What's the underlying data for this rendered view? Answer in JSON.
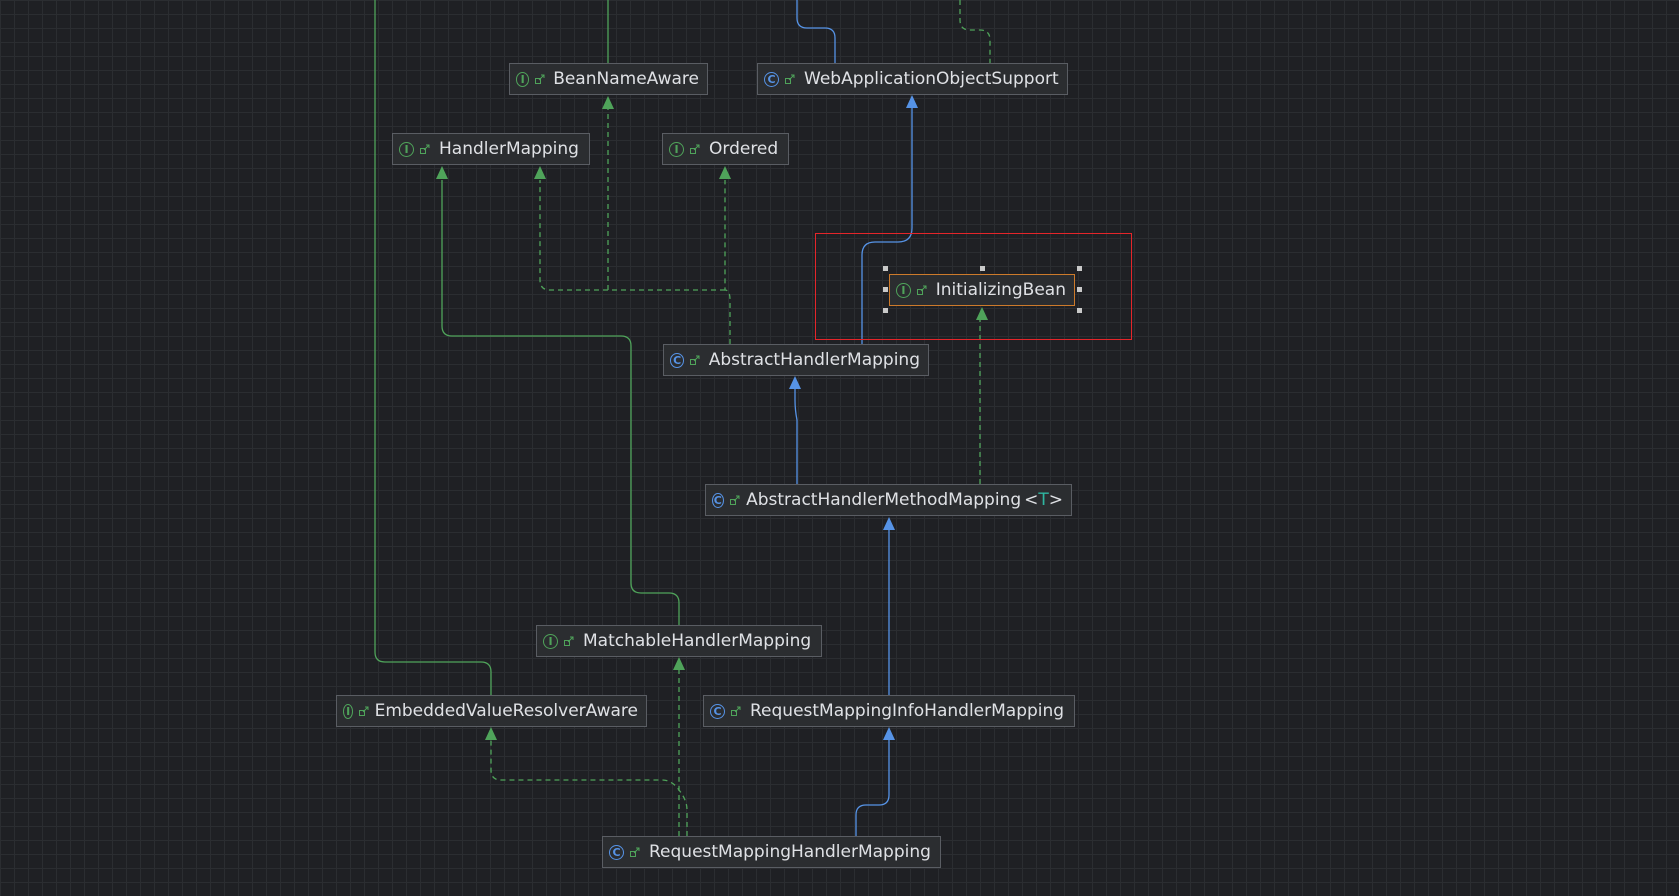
{
  "diagram": {
    "nodes": [
      {
        "id": "BeanNameAware",
        "label": "BeanNameAware",
        "kind": "interface"
      },
      {
        "id": "WebApplicationObjectSupport",
        "label": "WebApplicationObjectSupport",
        "kind": "class"
      },
      {
        "id": "HandlerMapping",
        "label": "HandlerMapping",
        "kind": "interface"
      },
      {
        "id": "Ordered",
        "label": "Ordered",
        "kind": "interface"
      },
      {
        "id": "InitializingBean",
        "label": "InitializingBean",
        "kind": "interface",
        "selected": true
      },
      {
        "id": "AbstractHandlerMapping",
        "label": "AbstractHandlerMapping",
        "kind": "class"
      },
      {
        "id": "AbstractHandlerMethodMapping",
        "label": "AbstractHandlerMethodMapping",
        "type_param": "T",
        "kind": "class"
      },
      {
        "id": "MatchableHandlerMapping",
        "label": "MatchableHandlerMapping",
        "kind": "interface"
      },
      {
        "id": "EmbeddedValueResolverAware",
        "label": "EmbeddedValueResolverAware",
        "kind": "interface"
      },
      {
        "id": "RequestMappingInfoHandlerMapping",
        "label": "RequestMappingInfoHandlerMapping",
        "kind": "class"
      },
      {
        "id": "RequestMappingHandlerMapping",
        "label": "RequestMappingHandlerMapping",
        "kind": "class"
      }
    ],
    "edges": [
      {
        "from": "AbstractHandlerMapping",
        "to": "WebApplicationObjectSupport",
        "type": "extends"
      },
      {
        "from": "AbstractHandlerMapping",
        "to": "HandlerMapping",
        "type": "implements"
      },
      {
        "from": "AbstractHandlerMapping",
        "to": "Ordered",
        "type": "implements"
      },
      {
        "from": "AbstractHandlerMapping",
        "to": "BeanNameAware",
        "type": "implements"
      },
      {
        "from": "AbstractHandlerMethodMapping",
        "to": "AbstractHandlerMapping",
        "type": "extends"
      },
      {
        "from": "AbstractHandlerMethodMapping",
        "to": "InitializingBean",
        "type": "implements"
      },
      {
        "from": "RequestMappingInfoHandlerMapping",
        "to": "AbstractHandlerMethodMapping",
        "type": "extends"
      },
      {
        "from": "MatchableHandlerMapping",
        "to": "HandlerMapping",
        "type": "extends-interface"
      },
      {
        "from": "RequestMappingHandlerMapping",
        "to": "RequestMappingInfoHandlerMapping",
        "type": "extends"
      },
      {
        "from": "RequestMappingHandlerMapping",
        "to": "MatchableHandlerMapping",
        "type": "implements"
      },
      {
        "from": "RequestMappingHandlerMapping",
        "to": "EmbeddedValueResolverAware",
        "type": "implements"
      }
    ],
    "colors": {
      "extends": "#5693e6",
      "implements": "#4fa35a",
      "selection": "#e5252a",
      "selected_node_border": "#cc7a2b"
    }
  }
}
